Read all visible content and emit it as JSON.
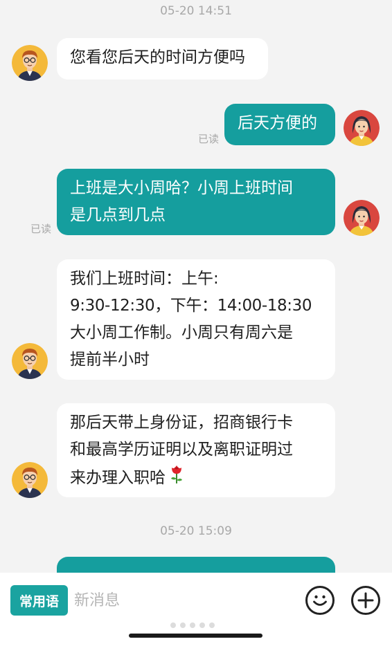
{
  "timestamps": [
    "05-20 14:51",
    "05-20 15:09"
  ],
  "messages": [
    {
      "side": "in",
      "text": "您看您后天的时间方便吗"
    },
    {
      "side": "out",
      "text": "后天方便的",
      "status": "已读"
    },
    {
      "side": "out",
      "lines": [
        "上班是大小周哈？小周上班时间",
        "是几点到几点"
      ],
      "status": "已读"
    },
    {
      "side": "in",
      "lines": [
        "我们上班时间：上午:",
        "9:30-12:30，下午：14:00-18:30",
        "大小周工作制。小周只有周六是",
        "提前半小时"
      ]
    },
    {
      "side": "in",
      "lines": [
        "那后天带上身份证，招商银行卡",
        "和最高学历证明以及离职证明过",
        "来办理入职哈"
      ],
      "emoji": "rose-emoji"
    },
    {
      "side": "out",
      "text": "",
      "partial": true
    }
  ],
  "input_bar": {
    "quick_phrase_label": "常用语",
    "placeholder": "新消息",
    "icons": [
      "emoji-icon",
      "plus-icon"
    ]
  },
  "colors": {
    "accent": "#159e9e",
    "background": "#f3f3f3",
    "incoming_bubble": "#ffffff",
    "timestamp": "#a8a8a8"
  }
}
